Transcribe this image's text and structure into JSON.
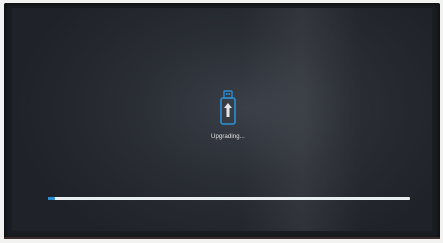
{
  "upgrade": {
    "status_text": "Upgrading...",
    "icon": "usb-drive-upgrade-icon",
    "progress": 0.02
  },
  "colors": {
    "screen_bg": "#2a2e35",
    "accent": "#2a8fd6",
    "track": "#e9eef0",
    "text": "#e6e6e6"
  }
}
